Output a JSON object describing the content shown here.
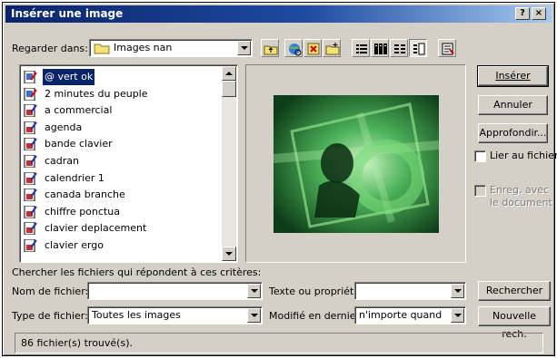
{
  "window": {
    "title": "Insérer une image",
    "help_button": "?",
    "close_button": "×"
  },
  "look_in": {
    "label": "Regarder dans:",
    "value": "Images nan",
    "folder_icon": "folder-icon"
  },
  "toolbar": {
    "icons": [
      "up-one-level-icon",
      "search-web-icon",
      "delete-icon",
      "create-folder-icon",
      "list-view-icon",
      "details-view-icon",
      "properties-view-icon",
      "preview-view-icon",
      "tools-icon"
    ]
  },
  "file_list": {
    "items": [
      {
        "name": "@ vert ok",
        "icon": "clipart-file-icon",
        "selected": true
      },
      {
        "name": "2 minutes du peuple",
        "icon": "clipart-file-icon",
        "selected": false
      },
      {
        "name": "a commercial",
        "icon": "image-file-icon",
        "selected": false
      },
      {
        "name": "agenda",
        "icon": "image-file-icon",
        "selected": false
      },
      {
        "name": "bande clavier",
        "icon": "image-file-icon",
        "selected": false
      },
      {
        "name": "cadran",
        "icon": "image-file-icon",
        "selected": false
      },
      {
        "name": "calendrier 1",
        "icon": "image-file-icon",
        "selected": false
      },
      {
        "name": "canada branche",
        "icon": "image-file-icon",
        "selected": false
      },
      {
        "name": "chiffre ponctua",
        "icon": "image-file-icon",
        "selected": false
      },
      {
        "name": "clavier deplacement",
        "icon": "image-file-icon",
        "selected": false
      },
      {
        "name": "clavier ergo",
        "icon": "image-file-icon",
        "selected": false
      }
    ]
  },
  "buttons": {
    "insert": "Insérer",
    "cancel": "Annuler",
    "advanced": "Approfondir...",
    "search": "Rechercher",
    "new_search": "Nouvelle rech."
  },
  "options": {
    "link_to_file": {
      "label": "Lier au fichier",
      "checked": false
    },
    "save_with_document": {
      "label": "Enreg. avec le document",
      "checked": false,
      "enabled": false
    }
  },
  "criteria": {
    "heading": "Chercher les fichiers qui répondent à ces critères:",
    "file_name_label": "Nom de fichier:",
    "file_name_value": "",
    "file_type_label": "Type de fichier:",
    "file_type_value": "Toutes les images",
    "text_property_label": "Texte ou propriété:",
    "text_property_value": "",
    "modified_label": "Modifié en dernier:",
    "modified_value": "n'importe quand"
  },
  "status": {
    "text": "86 fichier(s) trouvé(s)."
  },
  "colors": {
    "title_bar": "#0a246a",
    "dialog_face": "#d4d0c8",
    "selection": "#0a246a",
    "preview_green": "#2f9a46"
  }
}
